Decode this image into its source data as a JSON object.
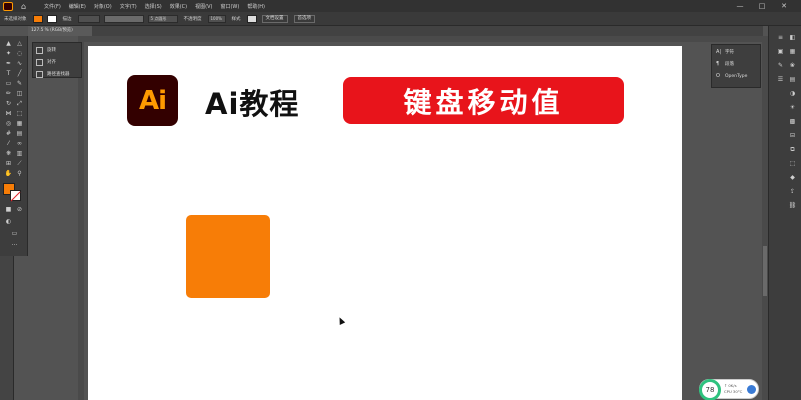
{
  "menubar": {
    "app_logo_icon": "ai-logo-icon",
    "home_icon": "home-icon",
    "menus": [
      "文件(F)",
      "编辑(E)",
      "对象(O)",
      "文字(T)",
      "选择(S)",
      "效果(C)",
      "视图(V)",
      "窗口(W)",
      "帮助(H)"
    ],
    "window_buttons": [
      "—",
      "□",
      "✕"
    ]
  },
  "controlbar": {
    "selection_label": "未选择对象",
    "stroke_label": "描边",
    "uniform_label": "5 点圆形",
    "opacity_label": "不透明度",
    "opacity_value": "100%",
    "style_label": "样式",
    "doc_setup_button": "文档设置",
    "preferences_button": "首选项"
  },
  "tab": {
    "label": "127.5 % (RGB/预览)"
  },
  "flyout": {
    "items": [
      {
        "label": "旋转"
      },
      {
        "label": "对齐"
      },
      {
        "label": "路径查找器"
      }
    ]
  },
  "artboard": {
    "logo_text": "Ai",
    "title": "Ai教程",
    "banner": "键盘移动值"
  },
  "rightpanel": {
    "items": [
      {
        "icon": "A|",
        "label": "字符"
      },
      {
        "icon": "¶",
        "label": "段落"
      },
      {
        "icon": "O",
        "label": "OpenType"
      }
    ]
  },
  "tray": {
    "percent": "78",
    "speed_up": "↑ 0K/s",
    "speed_down": "CPU 30°C"
  },
  "colors": {
    "accent_orange": "#f77d07",
    "banner_red": "#e8141b",
    "ai_logo_bg": "#330000",
    "ai_logo_text": "#ff9a00"
  }
}
